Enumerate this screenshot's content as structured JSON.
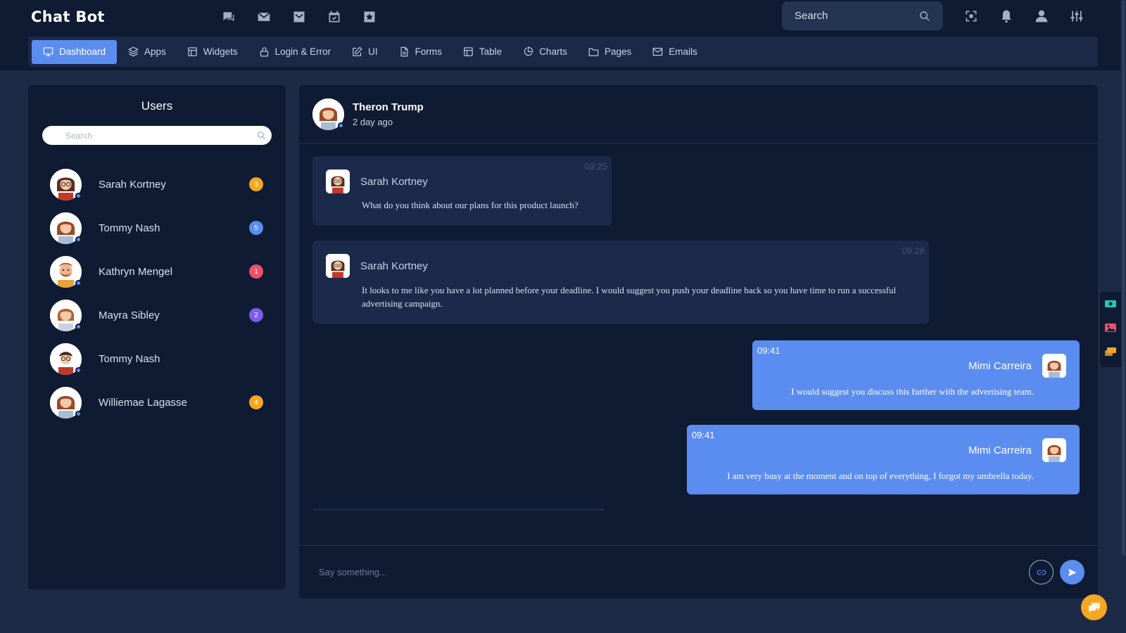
{
  "app": {
    "title": "Chat Bot"
  },
  "header": {
    "top_icons": [
      "chat-bubbles-icon",
      "mail-icon",
      "mail-open-icon",
      "calendar-icon",
      "star-icon"
    ],
    "search": {
      "placeholder": "Search"
    },
    "right_icons": [
      "fullscreen-icon",
      "bell-icon",
      "user-icon",
      "settings-sliders-icon"
    ]
  },
  "nav": {
    "active": "Dashboard",
    "items": [
      {
        "label": "Dashboard",
        "icon": "monitor-icon"
      },
      {
        "label": "Apps",
        "icon": "layers-icon"
      },
      {
        "label": "Widgets",
        "icon": "widget-icon"
      },
      {
        "label": "Login & Error",
        "icon": "lock-icon"
      },
      {
        "label": "UI",
        "icon": "edit-icon"
      },
      {
        "label": "Forms",
        "icon": "document-icon"
      },
      {
        "label": "Table",
        "icon": "table-icon"
      },
      {
        "label": "Charts",
        "icon": "pie-chart-icon"
      },
      {
        "label": "Pages",
        "icon": "folder-icon"
      },
      {
        "label": "Emails",
        "icon": "envelope-icon"
      }
    ]
  },
  "users": {
    "title": "Users",
    "search_placeholder": "Search",
    "list": [
      {
        "name": "Sarah Kortney",
        "badge": "3",
        "badge_color": "#f5a623",
        "avatar": "woman-glasses"
      },
      {
        "name": "Tommy Nash",
        "badge": "5",
        "badge_color": "#5b8df0",
        "avatar": "woman"
      },
      {
        "name": "Kathryn Mengel",
        "badge": "1",
        "badge_color": "#f0506e",
        "avatar": "man-beard"
      },
      {
        "name": "Mayra Sibley",
        "badge": "2",
        "badge_color": "#7e5bef",
        "avatar": "woman"
      },
      {
        "name": "Tommy Nash",
        "badge": "",
        "badge_color": "",
        "avatar": "man-glasses"
      },
      {
        "name": "Williemae Lagasse",
        "badge": "4",
        "badge_color": "#f5a623",
        "avatar": "woman"
      }
    ]
  },
  "chat": {
    "contact": {
      "name": "Theron Trump",
      "status": "2 day ago"
    },
    "messages": [
      {
        "direction": "in",
        "sender": "Sarah Kortney",
        "time": "09:25",
        "text": "What do you think about our plans for this product launch?"
      },
      {
        "direction": "in",
        "sender": "Sarah Kortney",
        "time": "09:28",
        "text": "It looks to me like you have a lot planned before your deadline. I would suggest you push your deadline back so you have time to run a successful advertising campaign."
      },
      {
        "direction": "out",
        "sender": "Mimi Carreira",
        "time": "09:41",
        "text": "I would suggest you discuss this further with the advertising team."
      },
      {
        "direction": "out",
        "sender": "Mimi Carreira",
        "time": "09:41",
        "text": "I am very busy at the moment and on top of everything, I forgot my umbrella today."
      }
    ],
    "input_placeholder": "Say something..."
  },
  "colors": {
    "accent": "#5b8df0",
    "panel": "#0f1a33",
    "background": "#1c2a45"
  }
}
